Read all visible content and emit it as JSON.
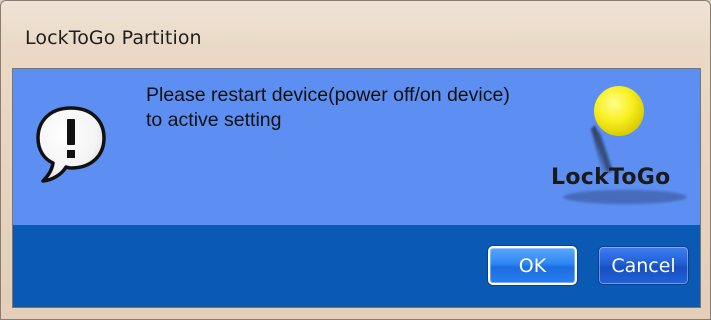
{
  "window": {
    "title": "LockToGo Partition"
  },
  "dialog": {
    "message": "Please restart device(power off/on device) to active setting",
    "icon": "exclamation-speech-bubble-icon",
    "logo_text": "LockToGo"
  },
  "buttons": {
    "ok_label": "OK",
    "cancel_label": "Cancel"
  },
  "colors": {
    "content_background": "#5d8ff2",
    "footer_background": "#0a5ab4",
    "button": "#2d86f2",
    "logo_ball": "#f5ec1a"
  }
}
